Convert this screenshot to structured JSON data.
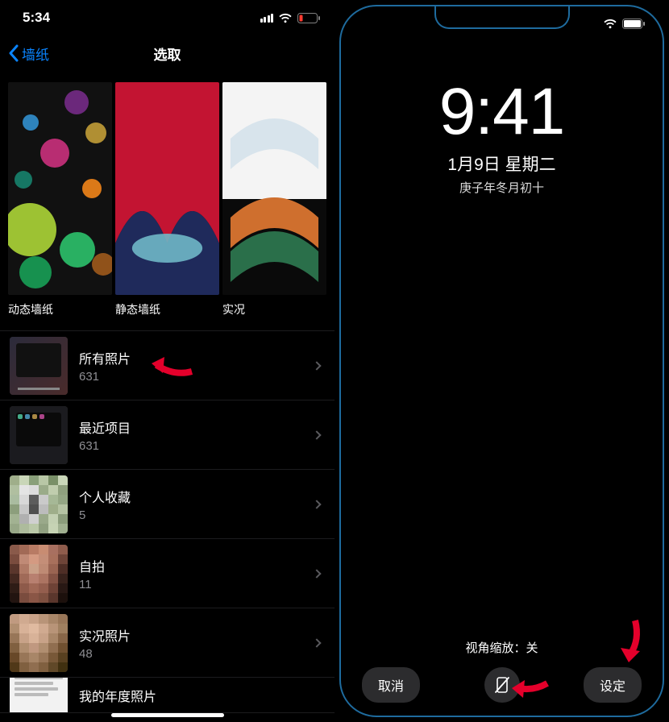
{
  "left": {
    "status": {
      "time": "5:34"
    },
    "nav": {
      "back": "墙纸",
      "title": "选取"
    },
    "wallpaper_cats": [
      {
        "label": "动态墙纸"
      },
      {
        "label": "静态墙纸"
      },
      {
        "label": "实况"
      }
    ],
    "albums": [
      {
        "title": "所有照片",
        "count": "631"
      },
      {
        "title": "最近项目",
        "count": "631"
      },
      {
        "title": "个人收藏",
        "count": "5"
      },
      {
        "title": "自拍",
        "count": "11"
      },
      {
        "title": "实况照片",
        "count": "48"
      },
      {
        "title": "我的年度照片",
        "count": ""
      }
    ]
  },
  "right": {
    "lock": {
      "time": "9:41",
      "date": "1月9日 星期二",
      "lunar": "庚子年冬月初十"
    },
    "perspective": "视角缩放：关",
    "buttons": {
      "cancel": "取消",
      "set": "设定"
    }
  },
  "colors": {
    "accent": "#0a84ff",
    "arrow": "#e4002b"
  }
}
